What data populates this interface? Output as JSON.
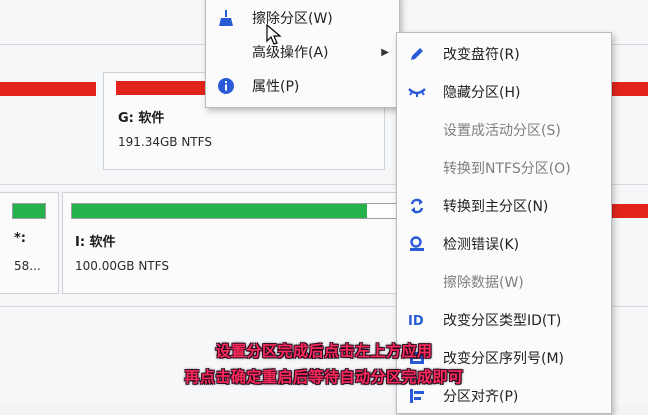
{
  "partitions": {
    "g": {
      "name": "G: 软件",
      "detail": "191.34GB NTFS"
    },
    "star": {
      "name": "*:",
      "detail": "58..."
    },
    "i": {
      "name": "I: 软件",
      "detail": "100.00GB NTFS"
    }
  },
  "context_menu": {
    "items": [
      {
        "label": "擦除分区(W)",
        "icon": "broom-icon"
      },
      {
        "label": "高级操作(A)",
        "icon": "none",
        "submenu": true
      },
      {
        "label": "属性(P)",
        "icon": "info-icon"
      }
    ]
  },
  "submenu": {
    "items": [
      {
        "label": "改变盘符(R)",
        "icon": "pencil-icon",
        "enabled": true
      },
      {
        "label": "隐藏分区(H)",
        "icon": "closed-eye-icon",
        "enabled": true
      },
      {
        "label": "设置成活动分区(S)",
        "icon": "none",
        "enabled": false
      },
      {
        "label": "转换到NTFS分区(O)",
        "icon": "none",
        "enabled": false
      },
      {
        "label": "转换到主分区(N)",
        "icon": "convert-arrows-icon",
        "enabled": true
      },
      {
        "label": "检测错误(K)",
        "icon": "magnifier-icon",
        "enabled": true
      },
      {
        "label": "擦除数据(W)",
        "icon": "none",
        "enabled": false
      },
      {
        "label": "改变分区类型ID(T)",
        "icon": "id-icon",
        "enabled": true
      },
      {
        "label": "改变分区序列号(M)",
        "icon": "serial-icon",
        "enabled": true
      },
      {
        "label": "分区对齐(P)",
        "icon": "align-icon",
        "enabled": true
      }
    ]
  },
  "caption": {
    "line1": "设置分区完成后点击左上方应用",
    "line2": "再点击确定重启后等待自动分区完成即可"
  },
  "colors": {
    "used_space_red": "#e2231a",
    "used_space_green": "#25b24a",
    "caption": "#ff2a5a",
    "icon_blue": "#2a5bd7"
  }
}
